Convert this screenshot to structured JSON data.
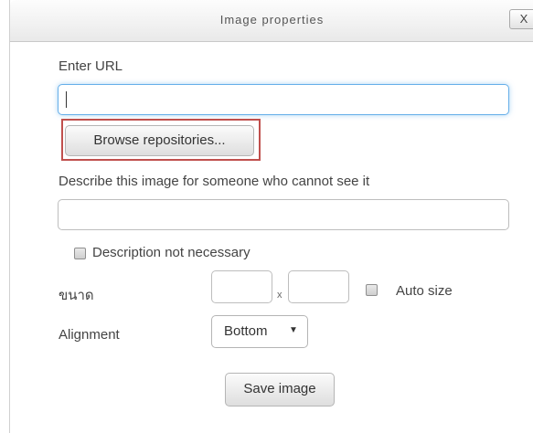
{
  "dialog": {
    "title": "Image properties",
    "close_label": "X"
  },
  "url": {
    "label": "Enter URL",
    "value": ""
  },
  "browse_button_label": "Browse repositories...",
  "description": {
    "label": "Describe this image for someone who cannot see it",
    "value": "",
    "not_necessary_label": "Description not necessary",
    "not_necessary_checked": false
  },
  "size": {
    "label": "ขนาด",
    "width_value": "",
    "height_value": "",
    "separator": "x",
    "auto_size_label": "Auto size",
    "auto_size_checked": false
  },
  "alignment": {
    "label": "Alignment",
    "selected": "Bottom",
    "arrow_icon": "triangle-down"
  },
  "save_button_label": "Save image",
  "colors": {
    "focus_border": "#66afe9",
    "highlight_box": "#c0504d"
  }
}
